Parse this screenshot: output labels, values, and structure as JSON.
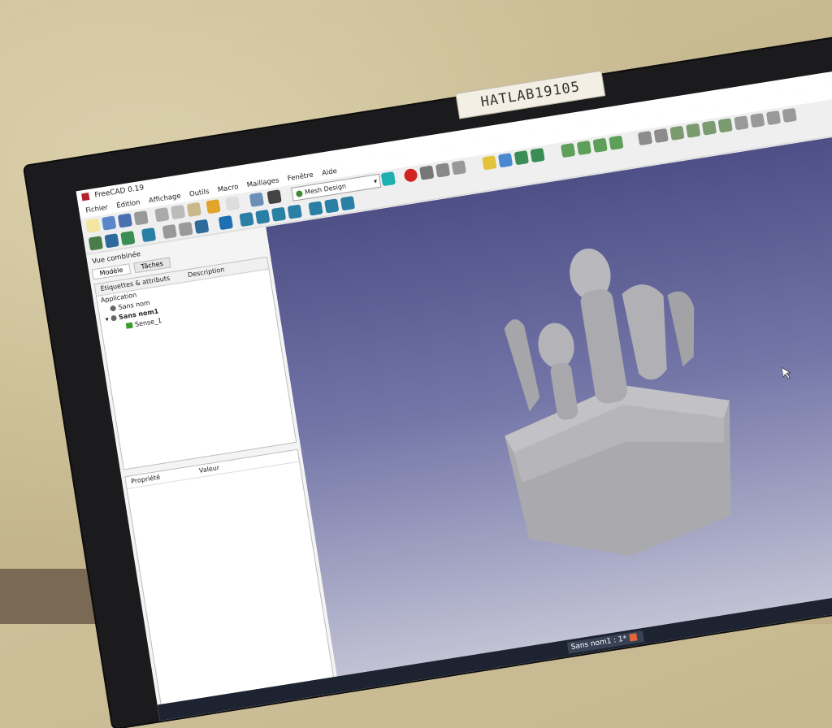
{
  "monitor_label": "HATLAB19105",
  "window": {
    "title": "FreeCAD 0.19"
  },
  "menu": [
    "Fichier",
    "Édition",
    "Affichage",
    "Outils",
    "Macro",
    "Maillages",
    "Fenêtre",
    "Aide"
  ],
  "workbench": {
    "selected": "Mesh Design"
  },
  "panel": {
    "title": "Vue combinée",
    "tabs": [
      "Modèle",
      "Tâches"
    ],
    "tree_headers": [
      "Étiquettes & attributs",
      "Description"
    ],
    "tree": {
      "root": "Application",
      "items": [
        "Sans nom",
        "Sans nom1"
      ],
      "child": "Sense_1"
    },
    "props_headers": [
      "Propriété",
      "Valeur"
    ]
  },
  "taskbar": {
    "item": "Sans nom1 : 1*"
  },
  "colors": {
    "viewport_top": "#4d4f86",
    "viewport_bottom": "#c7c7d8",
    "mesh": "#b4b4b8",
    "record": "#d32222"
  }
}
